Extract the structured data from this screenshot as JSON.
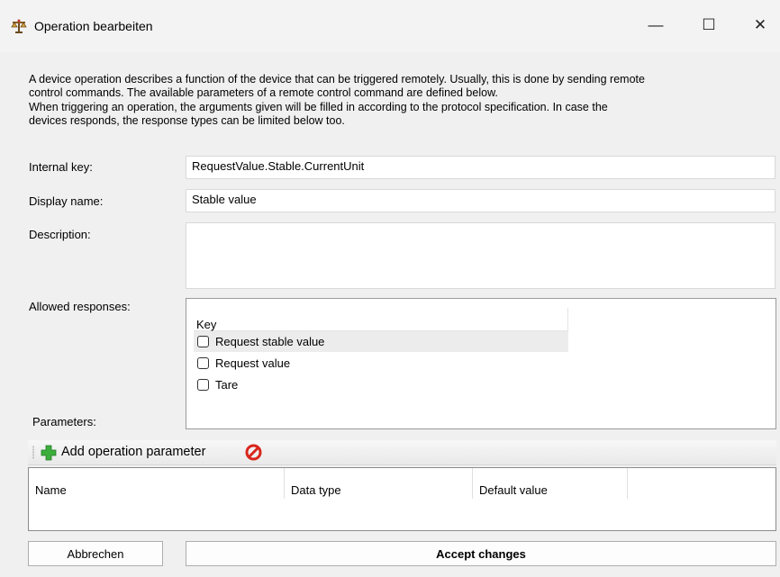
{
  "window": {
    "title": "Operation bearbeiten",
    "minimize_glyph": "—",
    "maximize_glyph": "☐",
    "close_glyph": "✕"
  },
  "description_lines": [
    "A device operation describes a function of the device that can be triggered remotely. Usually, this is done by sending remote",
    "control commands. The available parameters of a remote control command are defined below.",
    "When triggering an operation, the arguments given will be filled in according to the protocol specification. In case the",
    "devices responds, the response types can be limited below too."
  ],
  "form": {
    "internal_key_label": "Internal key:",
    "internal_key_value": "RequestValue.Stable.CurrentUnit",
    "display_name_label": "Display name:",
    "display_name_value": "Stable value",
    "description_label": "Description:",
    "description_value": "",
    "allowed_responses_label": "Allowed responses:",
    "parameters_label": "Parameters:"
  },
  "responses": {
    "column_header": "Key",
    "items": [
      {
        "label": "Request stable value",
        "checked": false,
        "selected": true
      },
      {
        "label": "Request value",
        "checked": false,
        "selected": false
      },
      {
        "label": "Tare",
        "checked": false,
        "selected": false
      }
    ]
  },
  "toolbar": {
    "add_label": "Add operation parameter",
    "add_icon": "green-plus-icon",
    "delete_icon": "red-prohibited-icon"
  },
  "parameters_grid": {
    "columns": [
      "Name",
      "Data type",
      "Default value"
    ]
  },
  "buttons": {
    "cancel": "Abbrechen",
    "accept": "Accept changes"
  },
  "colors": {
    "window_bg": "#f0f0f0",
    "add_icon_green": "#3cae3c",
    "delete_icon_red": "#d9261c"
  }
}
